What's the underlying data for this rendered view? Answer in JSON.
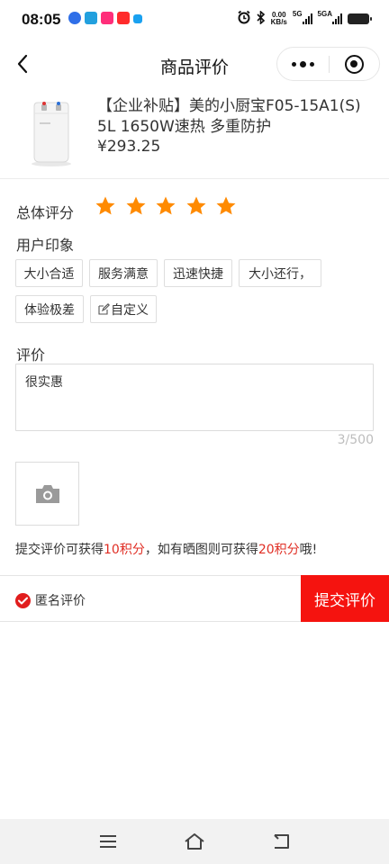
{
  "status_bar": {
    "time": "08:05",
    "net_speed_value": "0.00",
    "net_speed_unit": "KB/s",
    "signal_1": "5G",
    "signal_2": "5GA",
    "icons": [
      "baidu-app-icon",
      "telegram-icon",
      "taobao-live-icon",
      "live-app-icon",
      "tencent-icon",
      "alarm-icon",
      "bluetooth-icon",
      "battery-icon"
    ]
  },
  "nav": {
    "title": "商品评价"
  },
  "product": {
    "title": "【企业补贴】美的小厨宝F05-15A1(S) 5L 1650W速热 多重防护",
    "price": "¥293.25",
    "image_icon": "water-heater-image"
  },
  "rating": {
    "label": "总体评分",
    "stars_filled": 5,
    "stars_total": 5,
    "star_color": "#ff8a00"
  },
  "impression": {
    "label": "用户印象",
    "tags": [
      "大小合适",
      "服务满意",
      "迅速快捷",
      "大小还行，",
      "体验极差"
    ],
    "custom_tag": "自定义"
  },
  "review": {
    "label": "评价",
    "text": "很实惠",
    "counter": "3/500"
  },
  "photo": {
    "icon": "camera-icon"
  },
  "bonus": {
    "prefix": "提交评价可获得",
    "points_1": "10积分",
    "middle": "，如有晒图则可获得",
    "points_2": "20积分",
    "suffix": "哦!",
    "highlight_color": "#e02e24"
  },
  "footer": {
    "anonymous_label": "匿名评价",
    "anonymous_checked": true,
    "submit_label": "提交评价",
    "submit_color": "#f5130f"
  }
}
